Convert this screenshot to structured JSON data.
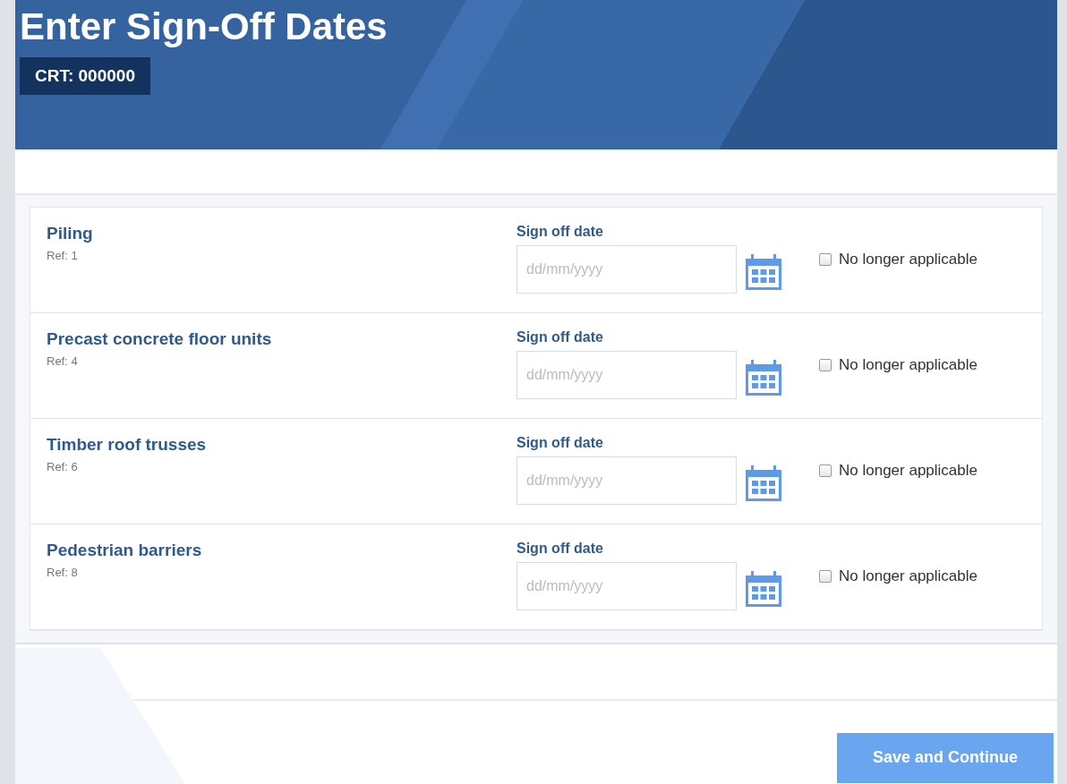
{
  "header": {
    "title": "Enter Sign-Off Dates",
    "badge": "CRT: 000000"
  },
  "items": [
    {
      "name": "Piling",
      "ref": "Ref: 1",
      "date_label": "Sign off date",
      "placeholder": "dd/mm/yyyy",
      "not_applicable": {
        "label": "No longer applicable",
        "checked": false
      }
    },
    {
      "name": "Precast concrete floor units",
      "ref": "Ref: 4",
      "date_label": "Sign off date",
      "placeholder": "dd/mm/yyyy",
      "not_applicable": {
        "label": "No longer applicable",
        "checked": false
      }
    },
    {
      "name": "Timber roof trusses",
      "ref": "Ref: 6",
      "date_label": "Sign off date",
      "placeholder": "dd/mm/yyyy",
      "not_applicable": {
        "label": "No longer applicable",
        "checked": false
      }
    },
    {
      "name": "Pedestrian barriers",
      "ref": "Ref: 8",
      "date_label": "Sign off date",
      "placeholder": "dd/mm/yyyy",
      "not_applicable": {
        "label": "No longer applicable",
        "checked": false
      }
    }
  ],
  "save_button": "Save and Continue"
}
